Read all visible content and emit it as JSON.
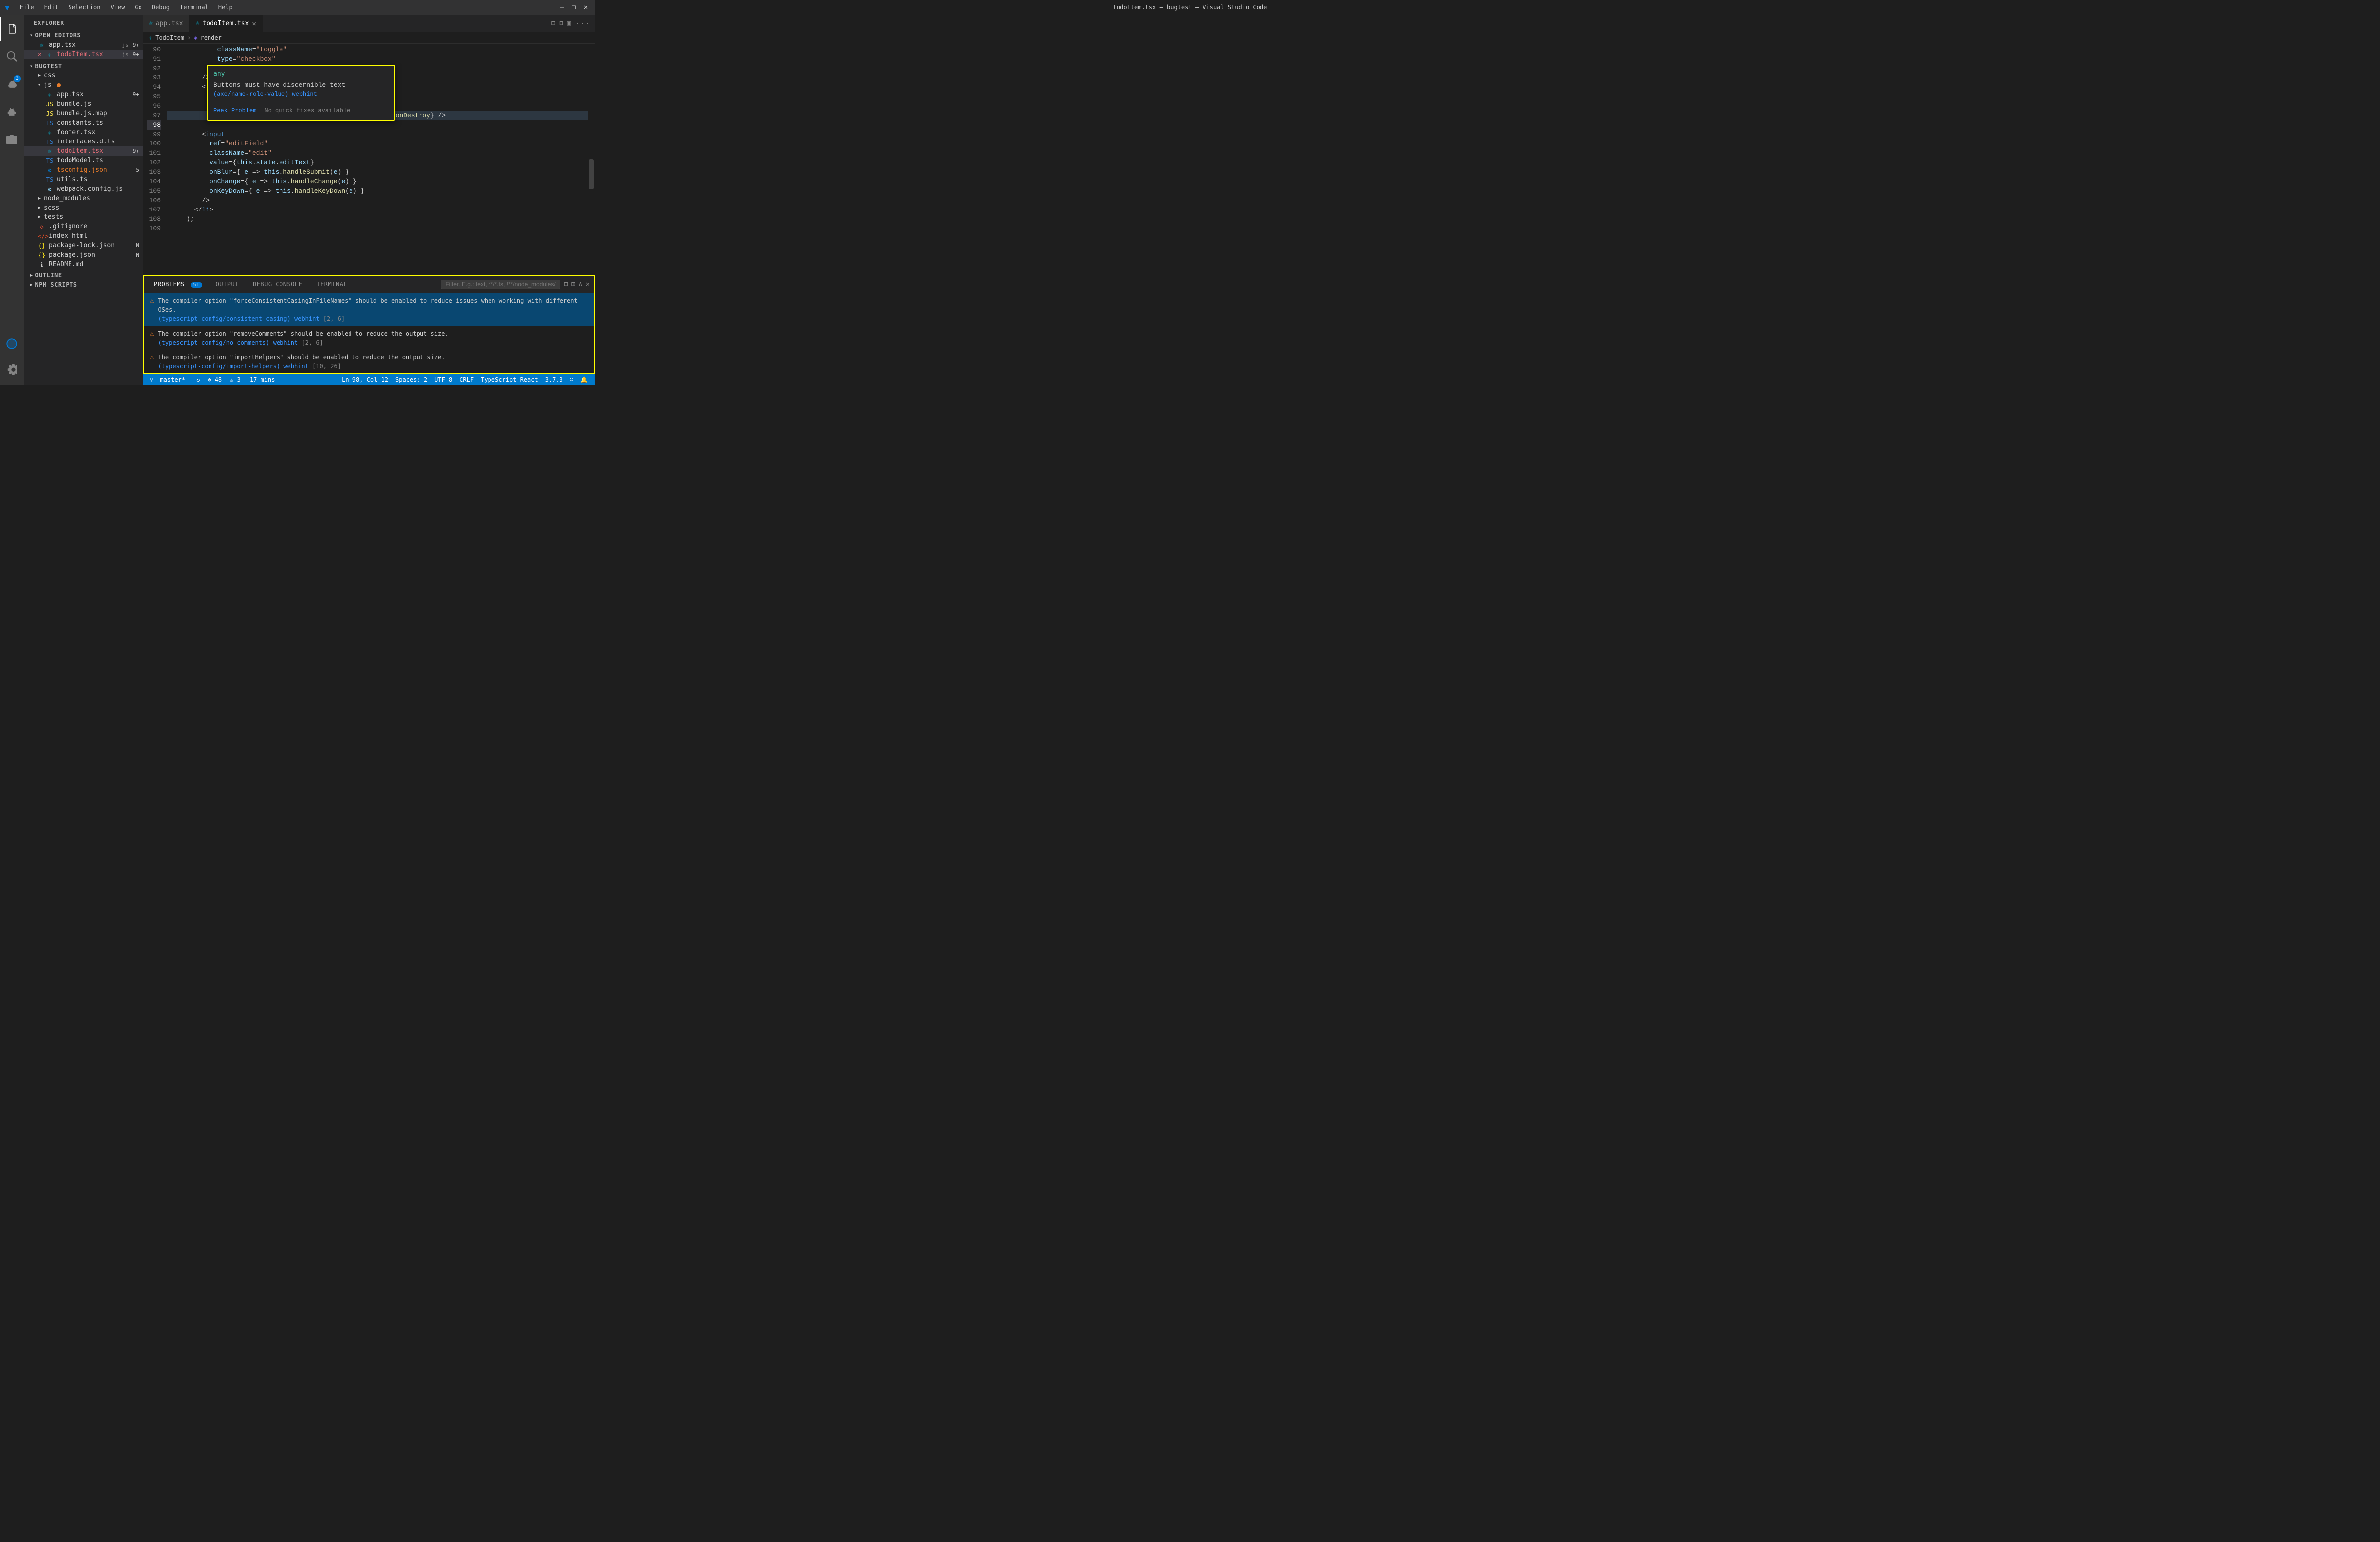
{
  "titlebar": {
    "logo": "VS",
    "menu": [
      "File",
      "Edit",
      "Selection",
      "View",
      "Go",
      "Debug",
      "Terminal",
      "Help"
    ],
    "title": "todoItem.tsx — bugtest — Visual Studio Code",
    "buttons": [
      "—",
      "❐",
      "✕"
    ]
  },
  "activity": {
    "icons": [
      "explorer",
      "search",
      "source-control",
      "debug",
      "extensions",
      "remote-explorer",
      "settings"
    ],
    "scm_badge": "3"
  },
  "sidebar": {
    "title": "EXPLORER",
    "open_editors_label": "OPEN EDITORS",
    "open_editors": [
      {
        "name": "app.tsx",
        "lang": "tsx",
        "badge": "9+",
        "icon": "⚛"
      },
      {
        "name": "todoItem.tsx",
        "lang": "tsx",
        "badge": "9+",
        "icon": "⚛",
        "active": true,
        "modified": true
      }
    ],
    "project_label": "BUGTEST",
    "folders": [
      {
        "name": "css",
        "indent": 1,
        "type": "folder"
      },
      {
        "name": "js",
        "indent": 1,
        "type": "folder",
        "dot": true
      },
      {
        "name": "app.tsx",
        "indent": 2,
        "type": "tsx",
        "badge": "9+"
      },
      {
        "name": "bundle.js",
        "indent": 2,
        "type": "js"
      },
      {
        "name": "bundle.js.map",
        "indent": 2,
        "type": "js"
      },
      {
        "name": "constants.ts",
        "indent": 2,
        "type": "ts"
      },
      {
        "name": "footer.tsx",
        "indent": 2,
        "type": "tsx"
      },
      {
        "name": "interfaces.d.ts",
        "indent": 2,
        "type": "ts"
      },
      {
        "name": "todoItem.tsx",
        "indent": 2,
        "type": "tsx",
        "badge": "9+",
        "active": true
      },
      {
        "name": "todoModel.ts",
        "indent": 2,
        "type": "ts"
      },
      {
        "name": "tsconfig.json",
        "indent": 2,
        "type": "json",
        "badge": "5"
      },
      {
        "name": "utils.ts",
        "indent": 2,
        "type": "ts"
      },
      {
        "name": "webpack.config.js",
        "indent": 2,
        "type": "js"
      },
      {
        "name": "node_modules",
        "indent": 1,
        "type": "folder",
        "collapsed": true
      },
      {
        "name": "scss",
        "indent": 1,
        "type": "folder",
        "collapsed": true
      },
      {
        "name": "tests",
        "indent": 1,
        "type": "folder",
        "collapsed": true
      },
      {
        "name": ".gitignore",
        "indent": 1,
        "type": "gitignore"
      },
      {
        "name": "index.html",
        "indent": 1,
        "type": "html"
      },
      {
        "name": "package-lock.json",
        "indent": 1,
        "type": "json",
        "badge": "N"
      },
      {
        "name": "package.json",
        "indent": 1,
        "type": "json",
        "badge": "N"
      },
      {
        "name": "README.md",
        "indent": 1,
        "type": "md"
      }
    ],
    "outline_label": "OUTLINE",
    "npm_scripts_label": "NPM SCRIPTS"
  },
  "tabs": [
    {
      "name": "app.tsx",
      "icon": "⚛",
      "active": false
    },
    {
      "name": "todoItem.tsx",
      "icon": "⚛",
      "active": true,
      "modified": true
    }
  ],
  "breadcrumb": {
    "items": [
      "TodoItem",
      "render"
    ]
  },
  "code": {
    "lines": [
      {
        "num": 90,
        "text": "            className=\"toggle\""
      },
      {
        "num": 91,
        "text": "            type=\"checkbox\""
      },
      {
        "num": 92,
        "text": "          />"
      },
      {
        "num": 93,
        "text": "          "
      },
      {
        "num": 94,
        "text": "        />"
      },
      {
        "num": 95,
        "text": "        <"
      },
      {
        "num": 96,
        "text": "        "
      },
      {
        "num": 97,
        "text": "        "
      },
      {
        "num": 98,
        "text": "          <button className=\"destroy\" onClick={this.props.onDestroy} />"
      },
      {
        "num": 99,
        "text": "        "
      },
      {
        "num": 100,
        "text": "        <input"
      },
      {
        "num": 101,
        "text": "          ref=\"editField\""
      },
      {
        "num": 102,
        "text": "          className=\"edit\""
      },
      {
        "num": 103,
        "text": "          value={this.state.editText}"
      },
      {
        "num": 104,
        "text": "          onBlur={ e => this.handleSubmit(e) }"
      },
      {
        "num": 105,
        "text": "          onChange={ e => this.handleChange(e) }"
      },
      {
        "num": 106,
        "text": "          onKeyDown={ e => this.handleKeyDown(e) }"
      },
      {
        "num": 107,
        "text": "        />"
      },
      {
        "num": 108,
        "text": "      </li>"
      },
      {
        "num": 109,
        "text": "    );"
      }
    ]
  },
  "tooltip": {
    "type": "any",
    "message": "Buttons must have discernible text\n(axe/name-role-value) webhint",
    "rule_text": "(axe/name-role-value) webhint",
    "peek_problem": "Peek Problem",
    "no_fixes": "No quick fixes available"
  },
  "panel": {
    "tabs": [
      "PROBLEMS",
      "OUTPUT",
      "DEBUG CONSOLE",
      "TERMINAL"
    ],
    "problems_badge": "51",
    "filter_placeholder": "Filter. E.g.: text, **/*.ts, !**/node_modules/**",
    "problems": [
      {
        "selected": true,
        "message": "The compiler option \"forceConsistentCasingInFileNames\" should be enabled to reduce issues when working with different OSes.",
        "rule": "(typescript-config/consistent-casing) webhint",
        "location": "[2, 6]"
      },
      {
        "message": "The compiler option \"removeComments\" should be enabled to reduce the output size.",
        "rule": "(typescript-config/no-comments) webhint",
        "location": "[2, 6]"
      },
      {
        "message": "The compiler option \"importHelpers\" should be enabled to reduce the output size.",
        "rule": "(typescript-config/import-helpers) webhint",
        "location": "[10, 26]"
      }
    ]
  },
  "statusbar": {
    "branch": "master*",
    "sync": "↻",
    "errors": "⊗ 48",
    "warnings": "⚠ 3",
    "time": "17 mins",
    "position": "Ln 98, Col 12",
    "spaces": "Spaces: 2",
    "encoding": "UTF-8",
    "line_ending": "CRLF",
    "language": "TypeScript React",
    "version": "3.7.3"
  }
}
